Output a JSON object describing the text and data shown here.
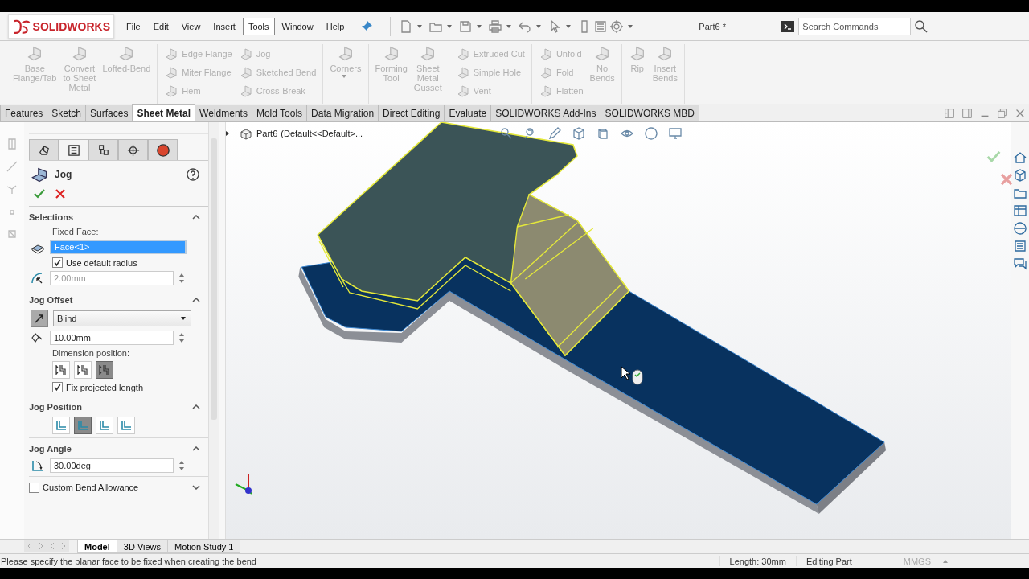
{
  "app": {
    "logo": "SOLIDWORKS",
    "title": "Part6 *"
  },
  "menu": [
    {
      "label": "File",
      "selected": false
    },
    {
      "label": "Edit",
      "selected": false
    },
    {
      "label": "View",
      "selected": false
    },
    {
      "label": "Insert",
      "selected": false
    },
    {
      "label": "Tools",
      "selected": true
    },
    {
      "label": "Window",
      "selected": false
    },
    {
      "label": "Help",
      "selected": false
    }
  ],
  "search": {
    "placeholder": "Search Commands"
  },
  "ribbon": [
    {
      "items": [
        {
          "kind": "large",
          "label": "Base\nFlange/Tab",
          "disabled": true
        },
        {
          "kind": "large",
          "label": "Convert\nto Sheet\nMetal",
          "disabled": true
        },
        {
          "kind": "large",
          "label": "Lofted-Bend",
          "disabled": true
        }
      ]
    },
    {
      "items": [
        {
          "kind": "small",
          "label": "Edge Flange",
          "disabled": true
        },
        {
          "kind": "small",
          "label": "Miter Flange",
          "disabled": true
        },
        {
          "kind": "small",
          "label": "Hem",
          "disabled": true
        },
        {
          "kind": "small",
          "label": "Jog",
          "disabled": true
        },
        {
          "kind": "small",
          "label": "Sketched Bend",
          "disabled": true
        },
        {
          "kind": "small",
          "label": "Cross-Break",
          "disabled": true
        }
      ]
    },
    {
      "items": [
        {
          "kind": "large",
          "label": "Corners",
          "disabled": true,
          "dropdown": true
        }
      ]
    },
    {
      "items": [
        {
          "kind": "large",
          "label": "Forming\nTool",
          "disabled": true
        },
        {
          "kind": "large",
          "label": "Sheet\nMetal\nGusset",
          "disabled": true
        }
      ]
    },
    {
      "items": [
        {
          "kind": "small",
          "label": "Extruded Cut",
          "disabled": true
        },
        {
          "kind": "small",
          "label": "Simple Hole",
          "disabled": true
        },
        {
          "kind": "small",
          "label": "Vent",
          "disabled": true
        }
      ]
    },
    {
      "items": [
        {
          "kind": "small",
          "label": "Unfold",
          "disabled": true
        },
        {
          "kind": "small",
          "label": "Fold",
          "disabled": true
        },
        {
          "kind": "small",
          "label": "Flatten",
          "disabled": true
        },
        {
          "kind": "large",
          "label": "No\nBends",
          "disabled": true
        }
      ]
    },
    {
      "items": [
        {
          "kind": "large",
          "label": "Rip",
          "disabled": true
        },
        {
          "kind": "large",
          "label": "Insert\nBends",
          "disabled": true
        }
      ]
    }
  ],
  "tabs": [
    {
      "label": "Features",
      "selected": false
    },
    {
      "label": "Sketch",
      "selected": false
    },
    {
      "label": "Surfaces",
      "selected": false
    },
    {
      "label": "Sheet Metal",
      "selected": true
    },
    {
      "label": "Weldments",
      "selected": false
    },
    {
      "label": "Mold Tools",
      "selected": false
    },
    {
      "label": "Data Migration",
      "selected": false
    },
    {
      "label": "Direct Editing",
      "selected": false
    },
    {
      "label": "Evaluate",
      "selected": false
    },
    {
      "label": "SOLIDWORKS Add-Ins",
      "selected": false
    },
    {
      "label": "SOLIDWORKS MBD",
      "selected": false
    }
  ],
  "property_manager": {
    "tabs": [
      {
        "kind": "feature",
        "selected": false
      },
      {
        "kind": "property",
        "selected": true
      },
      {
        "kind": "config",
        "selected": false
      },
      {
        "kind": "dimxpert",
        "selected": false
      },
      {
        "kind": "display",
        "selected": false
      }
    ],
    "title": "Jog",
    "selections": {
      "title": "Selections",
      "expanded": true,
      "fixed_face_label": "Fixed Face:",
      "fixed_face": {
        "value": "Face<1>",
        "focused": true
      },
      "use_default_radius": {
        "label": "Use default radius",
        "checked": true
      },
      "radius": {
        "value": "2.00mm",
        "disabled": true
      }
    },
    "jog_offset": {
      "title": "Jog Offset",
      "expanded": true,
      "end_condition": "Blind",
      "distance": {
        "value": "10.00mm",
        "disabled": false
      },
      "dimension_position_label": "Dimension position:",
      "dimension_positions": [
        {
          "selected": false
        },
        {
          "selected": false
        },
        {
          "selected": true
        }
      ],
      "fix_projected_length": {
        "label": "Fix projected length",
        "checked": true
      }
    },
    "jog_position": {
      "title": "Jog Position",
      "expanded": true,
      "options": [
        {
          "selected": false
        },
        {
          "selected": true
        },
        {
          "selected": false
        },
        {
          "selected": false
        }
      ]
    },
    "jog_angle": {
      "title": "Jog Angle",
      "expanded": true,
      "angle": {
        "value": "30.00deg",
        "disabled": false
      }
    },
    "custom_bend_allowance": {
      "title": "Custom Bend Allowance",
      "expanded": false,
      "checked": false
    }
  },
  "viewport": {
    "part_name": "Part6",
    "configuration": "(Default<<Default>..."
  },
  "bottom_tabs": [
    {
      "label": "Model",
      "selected": true
    },
    {
      "label": "3D Views",
      "selected": false
    },
    {
      "label": "Motion Study 1",
      "selected": false
    }
  ],
  "status_bar": {
    "message": "Please specify the planar face to be fixed when creating the bend",
    "length": "Length: 30mm",
    "mode": "Editing Part",
    "units": "MMGS"
  }
}
